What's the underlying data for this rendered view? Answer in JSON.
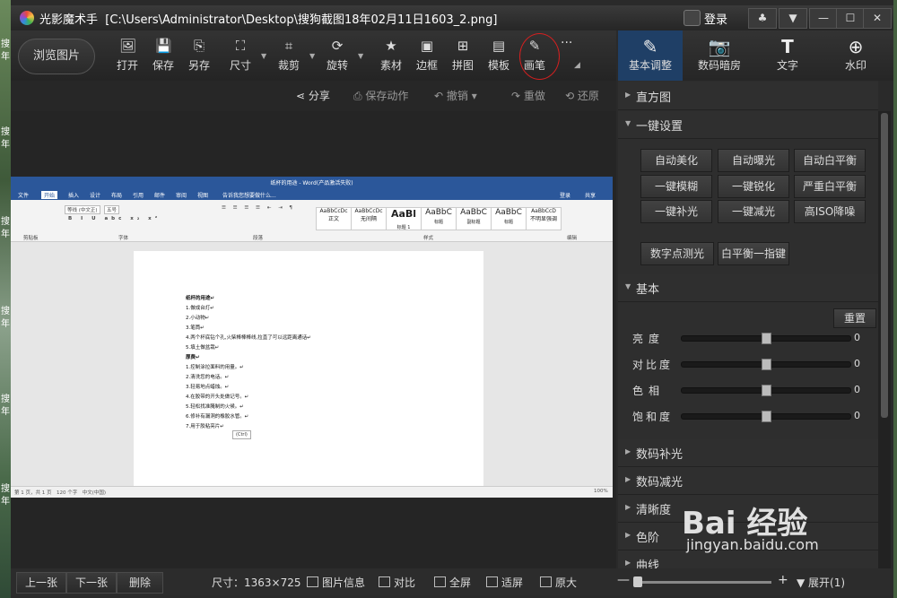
{
  "titlebar": {
    "app_name": "光影魔术手",
    "file_path": "[C:\\Users\\Administrator\\Desktop\\搜狗截图18年02月11日1603_2.png]",
    "login": "登录"
  },
  "toolbar": {
    "browse": "浏览图片",
    "buttons": [
      {
        "label": "打开",
        "icon": "open-icon"
      },
      {
        "label": "保存",
        "icon": "save-icon"
      },
      {
        "label": "另存",
        "icon": "save-as-icon"
      },
      {
        "label": "尺寸",
        "icon": "resize-icon"
      },
      {
        "label": "裁剪",
        "icon": "crop-icon"
      },
      {
        "label": "旋转",
        "icon": "rotate-icon"
      },
      {
        "label": "素材",
        "icon": "material-icon"
      },
      {
        "label": "边框",
        "icon": "border-icon"
      },
      {
        "label": "拼图",
        "icon": "collage-icon"
      },
      {
        "label": "模板",
        "icon": "template-icon"
      },
      {
        "label": "画笔",
        "icon": "brush-icon"
      }
    ],
    "more": "···"
  },
  "subbar": {
    "share": "分享",
    "save_action": "保存动作",
    "undo": "撤销",
    "redo": "重做",
    "restore": "还原"
  },
  "right_tabs": [
    {
      "label": "基本调整",
      "icon": "basic-adjust-icon"
    },
    {
      "label": "数码暗房",
      "icon": "darkroom-icon"
    },
    {
      "label": "文字",
      "icon": "text-icon"
    },
    {
      "label": "水印",
      "icon": "watermark-icon"
    }
  ],
  "panel": {
    "histogram": "直方图",
    "one_click": "一键设置",
    "presets": [
      "自动美化",
      "自动曝光",
      "自动白平衡",
      "一键模糊",
      "一键锐化",
      "严重白平衡",
      "一键补光",
      "一键减光",
      "高ISO降噪"
    ],
    "presets2": [
      "数字点测光",
      "白平衡一指键"
    ],
    "basic": "基本",
    "reset": "重置",
    "sliders": [
      {
        "label": "亮度",
        "value": "0",
        "level": 0.5
      },
      {
        "label": "对比度",
        "value": "0",
        "level": 0.5
      },
      {
        "label": "色相",
        "value": "0",
        "level": 0.5
      },
      {
        "label": "饱和度",
        "value": "0",
        "level": 0.5
      }
    ],
    "sections": [
      "数码补光",
      "数码减光",
      "清晰度",
      "色阶",
      "曲线"
    ]
  },
  "bottombar": {
    "prev": "上一张",
    "next": "下一张",
    "delete": "删除",
    "size_label": "尺寸：1363×725",
    "info": "图片信息",
    "compare": "对比",
    "fullscreen": "全屏",
    "fit": "适屏",
    "original": "原大",
    "expand": "展开(1)"
  },
  "word": {
    "title": "纸杯的用途 - Word(产品激活失败)",
    "tabs": [
      "文件",
      "开始",
      "插入",
      "设计",
      "布局",
      "引用",
      "邮件",
      "审阅",
      "视图"
    ],
    "search_hint": "告诉我您想要做什么...",
    "login": "登录",
    "share": "共享",
    "font": "等线 (中文正)",
    "font_size": "五号",
    "styles": [
      "AaBbCcDc",
      "AaBbCcDc",
      "AaBl",
      "AaBbC",
      "AaBbC",
      "AaBbC",
      "AaBbCcD"
    ],
    "style_names": [
      "正文",
      "无间隔",
      "标题 1",
      "标题",
      "副标题",
      "标题",
      "不明显强调"
    ],
    "groups": [
      "剪贴板",
      "字体",
      "段落",
      "样式",
      "编辑"
    ],
    "doc_lines": [
      "纸杯的用途↵",
      "1.做成台灯↵",
      "2.小动物↵",
      "3.笔筒↵",
      "4.两个杯底钻个孔,火柴棒棒棒线,拉直了可以远距离通话↵",
      "5.填土做盆栽↵",
      "厚费↵",
      "1.控制涂拉面料的用量。↵",
      "2.清洗您的电话。↵",
      "3.轻易地点蜡烛。↵",
      "4.在胶带的开头处做记号。↵",
      "5.轻松找准腌制的火候。↵",
      "6.修补有漏洞的橡胶水管。↵",
      "7.用于胶粘亮片↵"
    ],
    "paste_tag": "(Ctrl)",
    "status_left": "第 1 页，共 1 页　120 个字　中文(中国)",
    "status_zoom": "100%"
  },
  "desktop_chars": [
    "搜",
    "年",
    "搜",
    "年",
    "搜",
    "年",
    "搜",
    "年",
    "搜",
    "年",
    "搜",
    "年"
  ],
  "watermark": {
    "logo": "Bai 经验",
    "url": "jingyan.baidu.com"
  }
}
